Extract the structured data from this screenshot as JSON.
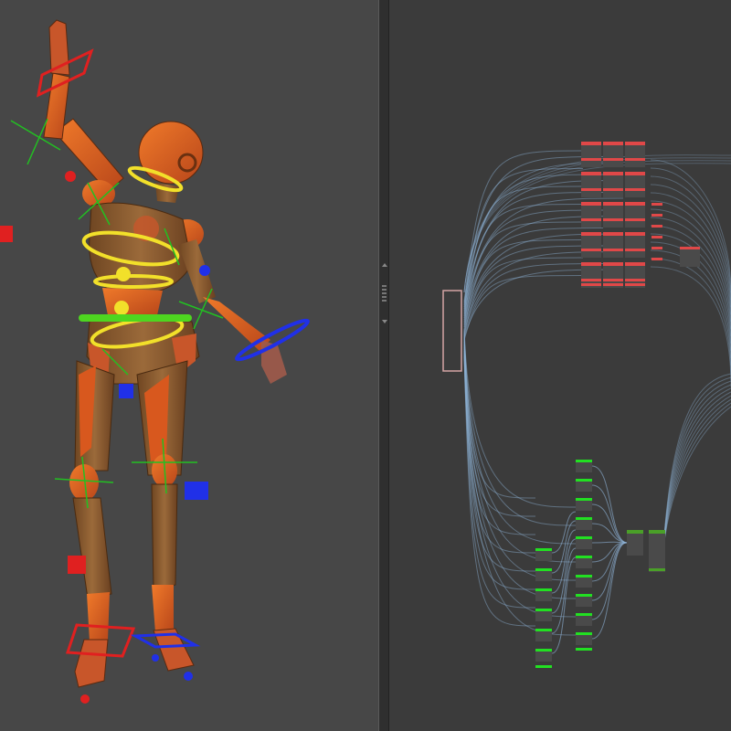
{
  "viewport": {
    "panel": "3d-viewport",
    "figure": "wooden-mannequin-rig",
    "colors": {
      "background": "#474747",
      "body": "#d9601e",
      "wood": "#8a5a2e",
      "fk_control": "#f2e02a",
      "ik_left": "#e02020",
      "ik_right": "#2030e8",
      "pivot_axis": "#22c022",
      "center_control": "#4ed620"
    }
  },
  "node_editor": {
    "panel": "rig-graph",
    "colors": {
      "background": "#3b3b3b",
      "wire": "#8fb4d8",
      "node_body": "#4a4a4a",
      "left_group_header": "#e04848",
      "right_group_header": "#22e022",
      "merge_header": "#4aa028",
      "root_outline": "#d4a4a4"
    }
  }
}
